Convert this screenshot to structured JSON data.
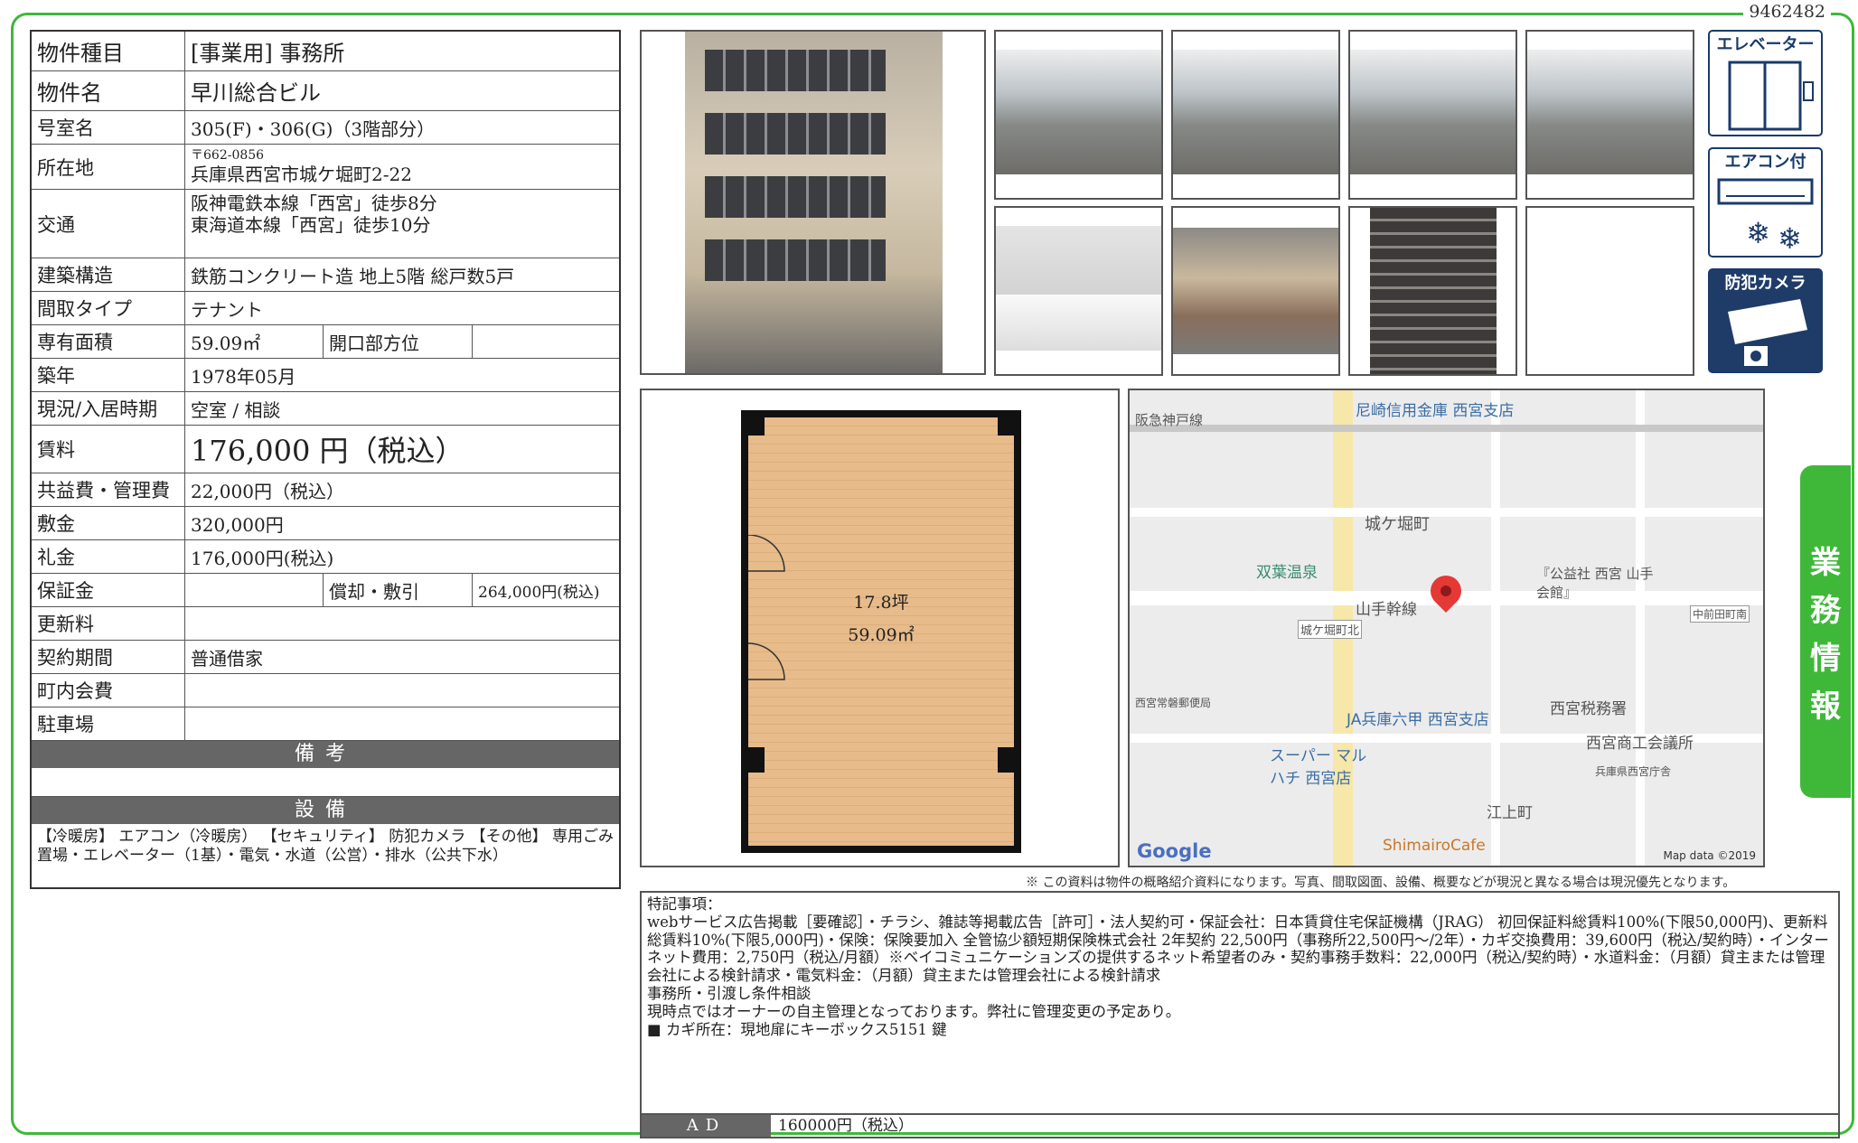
{
  "doc_id": "9462482",
  "spec": {
    "property_type": {
      "k": "物件種目",
      "v": "[事業用]  事務所"
    },
    "property_name": {
      "k": "物件名",
      "v": "早川総合ビル"
    },
    "room": {
      "k": "号室名",
      "v": "305(F)・306(G)（3階部分）"
    },
    "address": {
      "k": "所在地",
      "zip": "〒662-0856",
      "v": "兵庫県西宮市城ケ堀町2-22"
    },
    "access": {
      "k": "交通",
      "line1": "阪神電鉄本線「西宮」徒歩8分",
      "line2": "東海道本線「西宮」徒歩10分"
    },
    "structure": {
      "k": "建築構造",
      "v": "鉄筋コンクリート造  地上5階  総戸数5戸"
    },
    "layout": {
      "k": "間取タイプ",
      "v": "テナント"
    },
    "area": {
      "k": "専有面積",
      "v": "59.09㎡",
      "sub_k": "開口部方位",
      "sub_v": ""
    },
    "built": {
      "k": "築年",
      "v": "1978年05月"
    },
    "status": {
      "k": "現況/入居時期",
      "v": "空室  /  相談"
    },
    "rent": {
      "k": "賃料",
      "v": "176,000 円（税込）"
    },
    "common": {
      "k": "共益費・管理費",
      "v": "22,000円（税込）"
    },
    "deposit": {
      "k": "敷金",
      "v": "320,000円"
    },
    "key_money": {
      "k": "礼金",
      "v": "176,000円(税込)"
    },
    "guarantee": {
      "k": "保証金",
      "v": "",
      "sub_k": "償却・敷引",
      "sub_v": "264,000円(税込)"
    },
    "renewal": {
      "k": "更新料",
      "v": ""
    },
    "contract": {
      "k": "契約期間",
      "v": "普通借家"
    },
    "town_fee": {
      "k": "町内会費",
      "v": ""
    },
    "parking": {
      "k": "駐車場",
      "v": ""
    },
    "remarks_head": "備考",
    "remarks": "",
    "equipment_head": "設備",
    "equipment": "【冷暖房】 エアコン（冷暖房）  【セキュリティ】 防犯カメラ 【その他】 専用ごみ置場・エレベーター（1基）・電気・水道（公営）・排水（公共下水）"
  },
  "badges": {
    "elevator": "エレベーター",
    "aircon": "エアコン付",
    "camera": "防犯カメラ"
  },
  "floor_plan": {
    "tsubo": "17.8坪",
    "sqm": "59.09㎡"
  },
  "map": {
    "labels": {
      "hankyu": "阪急神戸線",
      "shinkin": "尼崎信用金庫 西宮支店",
      "jogabori": "城ケ堀町",
      "futaba": "双葉温泉",
      "yamate": "山手幹線",
      "jogabori_kita": "城ケ堀町北",
      "kominkan": "『公益社 西宮 山手会館』",
      "nakamaeda": "中前田町南",
      "post": "西宮常磐郵便局",
      "ja": "JA兵庫六甲 西宮支店",
      "tax": "西宮税務署",
      "super": "スーパー マルハチ 西宮店",
      "chamber": "西宮商工会議所",
      "pref": "兵庫県西宮庁舎",
      "egami": "江上町",
      "cafe": "ShimairoCafe"
    },
    "google": "Google",
    "mapdata": "Map data ©2019"
  },
  "note": "※ この資料は物件の概略紹介資料になります。写真、間取図面、設備、概要などが現況と異なる場合は現況優先となります。",
  "special": {
    "head": "特記事項：",
    "line1": "webサービス広告掲載［要確認］・チラシ、雑誌等掲載広告［許可］・法人契約可・保証会社：日本賃貸住宅保証機構（JRAG）  初回保証料総賃料100%(下限50,000円)、更新料総賃料10%(下限5,000円)・保険：保険要加入 全管協少額短期保険株式会社 2年契約 22,500円（事務所22,500円～/2年）・カギ交換費用：39,600円（税込/契約時）・インターネット費用：2,750円（税込/月額）※ベイコミュニケーションズの提供するネット希望者のみ・契約事務手数料：22,000円（税込/契約時）・水道料金：（月額）貸主または管理会社による検針請求・電気料金：（月額）貸主または管理会社による検針請求",
    "line2": "事務所・引渡し条件相談",
    "line3": "現時点ではオーナーの自主管理となっております。弊社に管理変更の予定あり。",
    "line4": "■ カギ所在：現地扉にキーボックス5151  鍵"
  },
  "ad": {
    "k": "AD",
    "v": "160000円（税込）"
  },
  "side_tab": [
    "業",
    "務",
    "情",
    "報"
  ],
  "colors": {
    "accent": "#3fb83a",
    "header": "#666666",
    "pin": "#e53935"
  }
}
